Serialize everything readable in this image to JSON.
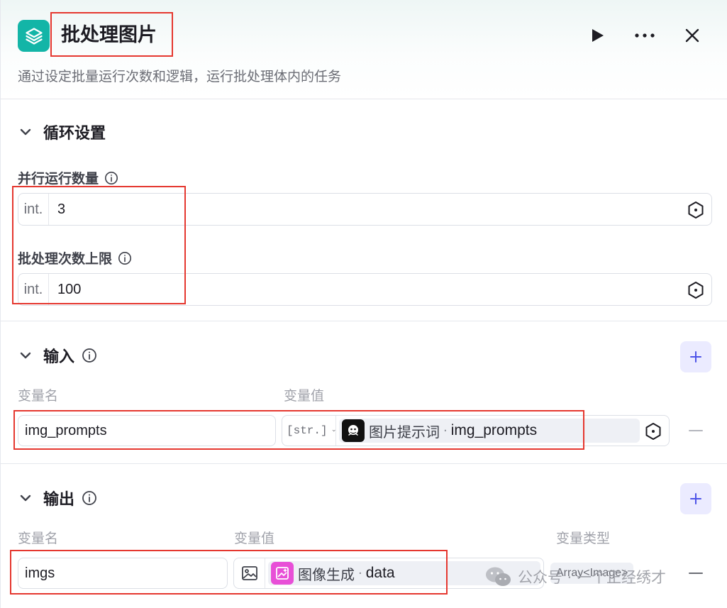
{
  "node": {
    "title": "批处理图片",
    "description": "通过设定批量运行次数和逻辑，运行批处理体内的任务",
    "icon": "layers-icon",
    "accent": "#13b5a7"
  },
  "header_actions": [
    "play-icon",
    "more-icon",
    "close-icon"
  ],
  "loop_settings": {
    "title": "循环设置",
    "concurrency": {
      "label": "并行运行数量",
      "prefix": "int.",
      "value": "3"
    },
    "batch_limit": {
      "label": "批处理次数上限",
      "prefix": "int.",
      "value": "100"
    }
  },
  "inputs": {
    "title": "输入",
    "col_name": "变量名",
    "col_value": "变量值",
    "rows": [
      {
        "name": "img_prompts",
        "type_tag": "[str.]",
        "source_node": "图片提示词",
        "source_var": "img_prompts"
      }
    ]
  },
  "outputs": {
    "title": "输出",
    "col_name": "变量名",
    "col_value": "变量值",
    "col_type": "变量类型",
    "rows": [
      {
        "name": "imgs",
        "source_node": "图像生成",
        "source_var": "data",
        "var_type": "Array<Image>"
      }
    ]
  },
  "watermark": "公众号 · 一个正经绣才",
  "colors": {
    "annotation": "#e5372f",
    "add_button_bg": "#ebebff",
    "add_button_fg": "#4d53e8",
    "image_node": "#e84fd7"
  }
}
